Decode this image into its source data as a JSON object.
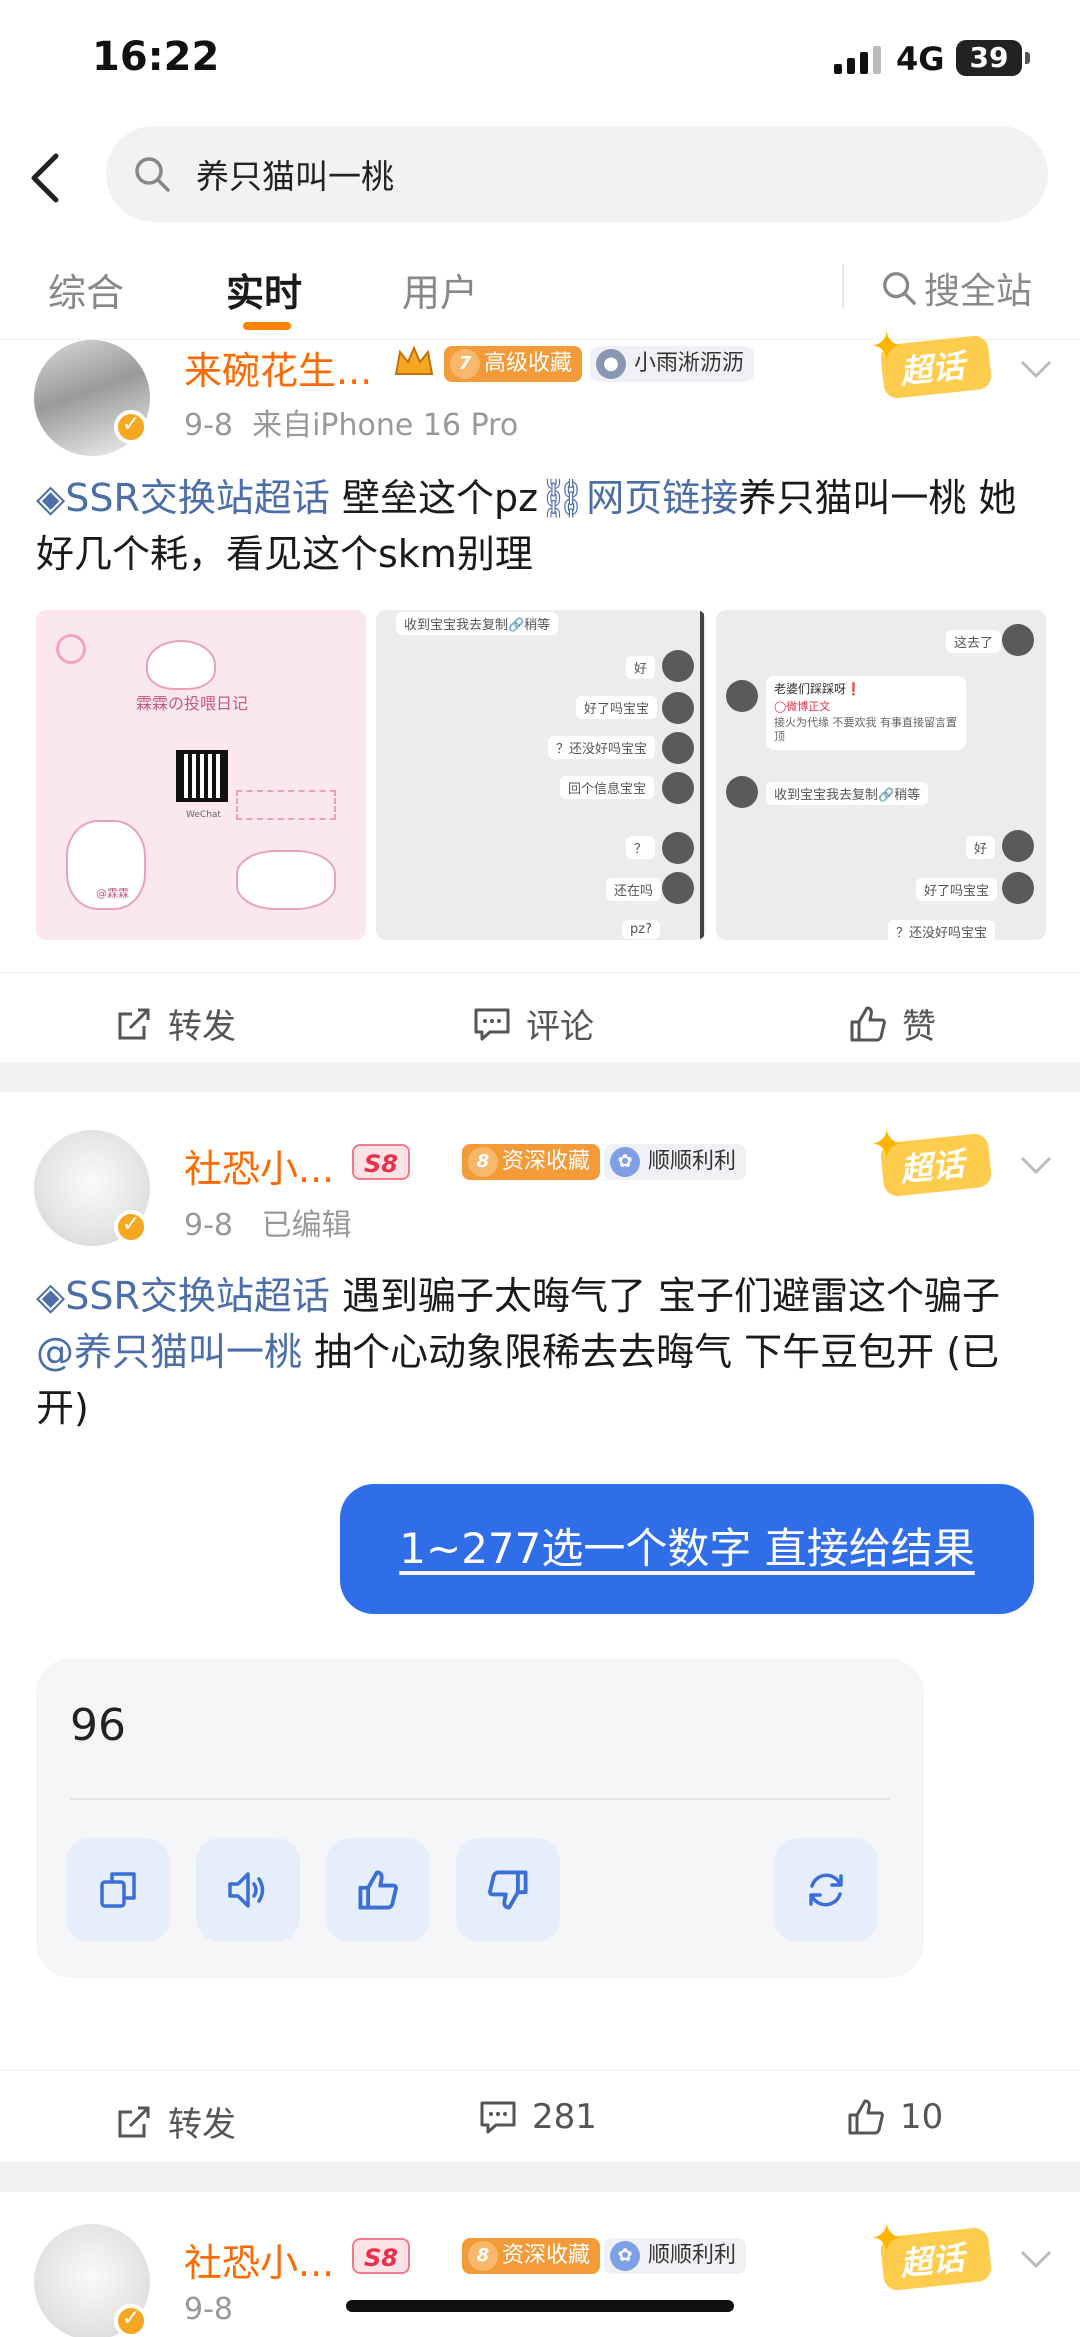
{
  "status_bar": {
    "time": "16:22",
    "network": "4G",
    "battery": "39"
  },
  "search": {
    "query": "养只猫叫一桃"
  },
  "tabs": [
    {
      "label": "综合"
    },
    {
      "label": "实时"
    },
    {
      "label": "用户"
    }
  ],
  "search_all_label": "搜全站",
  "posts": [
    {
      "username": "来碗花生...",
      "badge_level": "7",
      "badge_label": "高级收藏",
      "fan_badge": "小雨淅沥沥",
      "date": "9-8",
      "source": "来自iPhone 16 Pro",
      "chaohua": "超话",
      "topic": "SSR交换站超话",
      "text_a": " 壁垒这个pz",
      "link": "网页链接",
      "text_b": "养只猫叫一桃 她好几个耗，看见这个skm别理",
      "actions": {
        "repost": "转发",
        "comment": "评论",
        "like": "赞"
      },
      "image1_title": "霖霖の投喂日记",
      "image1_caption": "WeChat",
      "image1_handle": "@霖霖",
      "image2_lines": [
        "收到宝宝我去复制🔗稍等",
        "好",
        "好了吗宝宝",
        "？还没好吗宝宝",
        "回个信息宝宝",
        "？",
        "还在吗",
        "pz?"
      ],
      "image3_lines": [
        "这去了",
        "老婆们踩踩呀❗",
        "◯微博正文",
        "接火为代缘 不要欢我 有事直接留言置顶",
        "收到宝宝我去复制🔗稍等",
        "好",
        "好了吗宝宝",
        "？还没好吗宝宝"
      ]
    },
    {
      "username": "社恐小...",
      "s8": "S8",
      "badge_level": "8",
      "badge_label": "资深收藏",
      "fan_badge": "顺顺利利",
      "date": "9-8",
      "source": "已编辑",
      "chaohua": "超话",
      "topic": "SSR交换站超话",
      "text_a": " 遇到骗子太晦气了 宝子们避雷这个骗子 ",
      "mention": "@养只猫叫一桃",
      "text_b": " 抽个心动象限稀去去晦气  下午豆包开 (已开)",
      "chat_prompt": "1~277选一个数字 直接给结果",
      "chat_answer": "96",
      "actions": {
        "repost": "转发",
        "comment": "281",
        "like": "10"
      }
    },
    {
      "username": "社恐小...",
      "s8": "S8",
      "badge_level": "8",
      "badge_label": "资深收藏",
      "fan_badge": "顺顺利利",
      "date": "9-8",
      "chaohua": "超话"
    }
  ],
  "colors": {
    "accent": "#ff8200",
    "username": "#ff6a00",
    "topic": "#4b6ea8",
    "bubble": "#2f6ee8"
  }
}
